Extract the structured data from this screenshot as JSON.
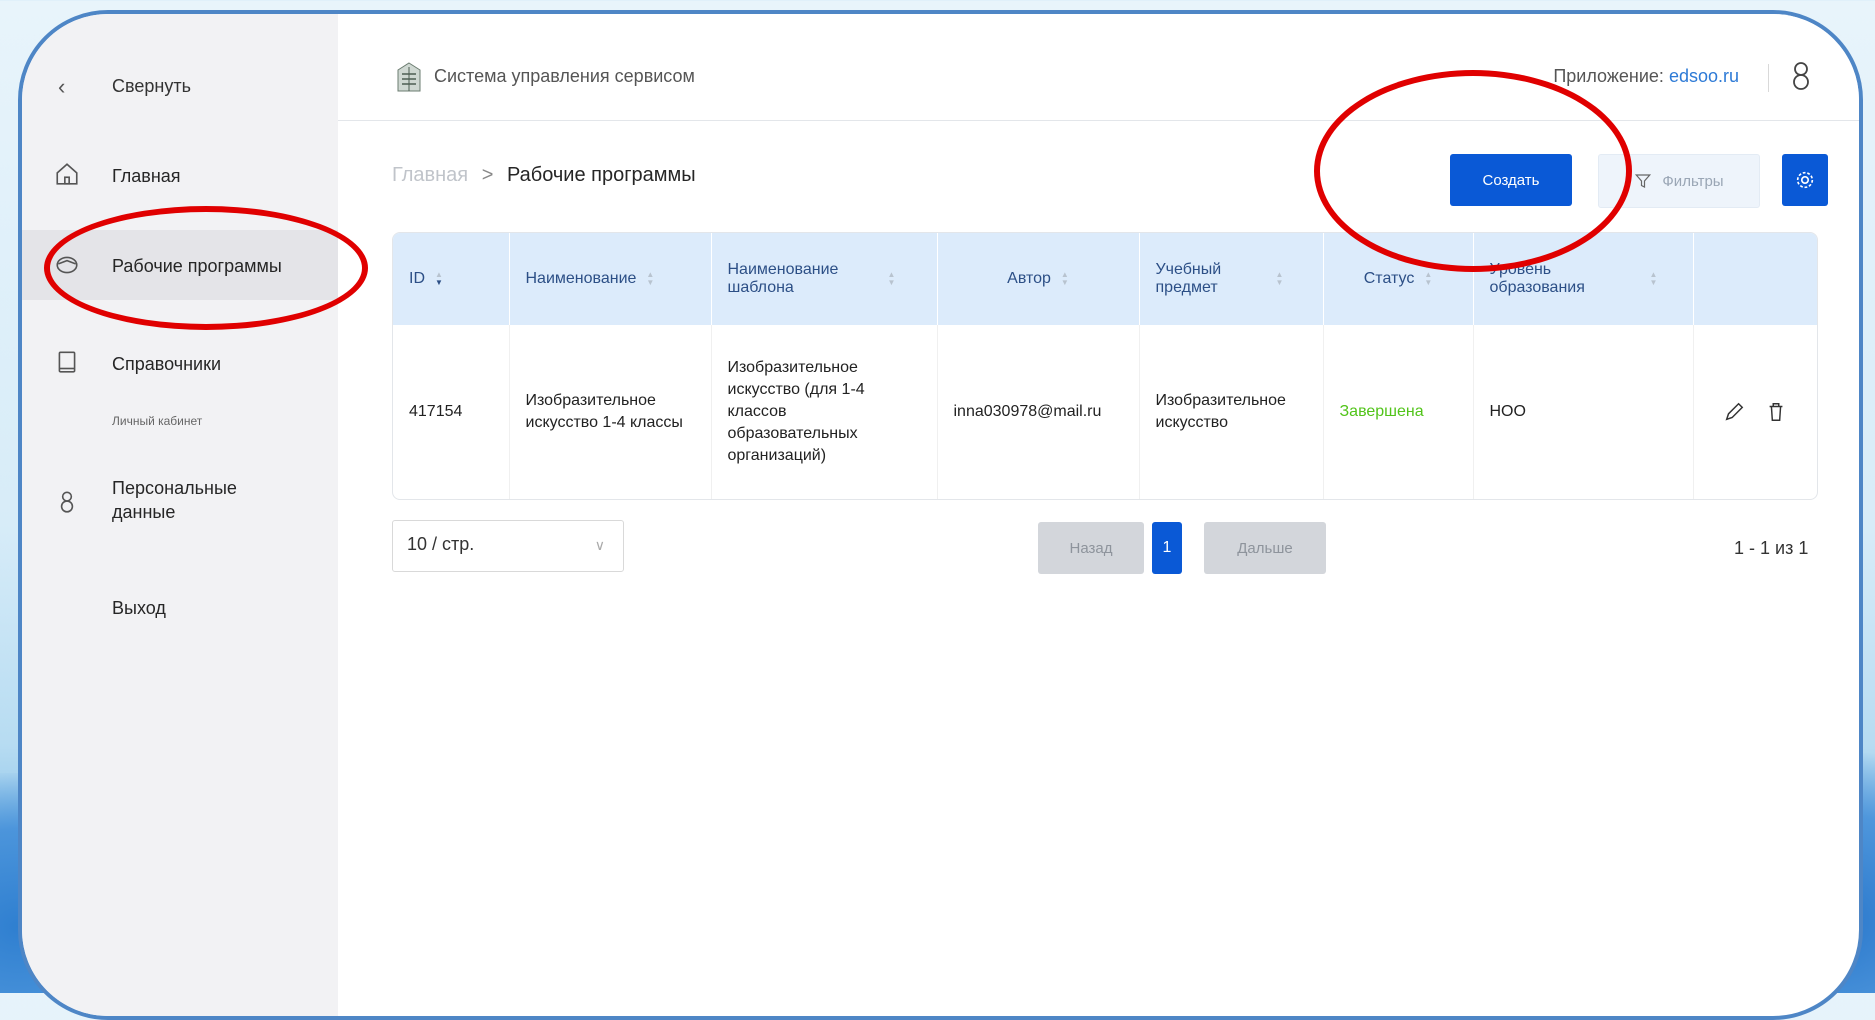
{
  "sidebar": {
    "collapse_label": "Свернуть",
    "items": [
      {
        "label": "Главная",
        "icon": "home-icon"
      },
      {
        "label": "Рабочие программы",
        "icon": "graduation-cap-icon",
        "active": true
      },
      {
        "label": "Справочники",
        "icon": "book-icon"
      }
    ],
    "caption": "Личный кабинет",
    "personal_label": "Персональные данные",
    "logout_label": "Выход"
  },
  "topbar": {
    "system_title": "Система управления сервисом",
    "app_prefix": "Приложение:",
    "app_link": "edsoo.ru"
  },
  "breadcrumb": {
    "home": "Главная",
    "separator": ">",
    "current": "Рабочие программы"
  },
  "toolbar": {
    "create_label": "Создать",
    "filter_label": "Фильтры"
  },
  "table": {
    "headers": [
      "ID",
      "Наименование",
      "Наименование шаблона",
      "Автор",
      "Учебный предмет",
      "Статус",
      "Уровень образования"
    ],
    "rows": [
      {
        "id": "417154",
        "name": "Изобразительное искусство 1-4 классы",
        "template": "Изобразительное искусство (для 1-4 классов образовательных организаций)",
        "author": "inna030978@mail.ru",
        "subject": "Изобразительное искусство",
        "status": "Завершена",
        "level": "НОО"
      }
    ]
  },
  "pagination": {
    "page_size": "10 / стр.",
    "prev_label": "Назад",
    "current_page": "1",
    "next_label": "Дальше",
    "range_text": "1 - 1 из 1"
  },
  "colors": {
    "accent": "#0a59d6",
    "header_bg": "#dcebfb",
    "status_done": "#52c41a",
    "annotation": "#e00000"
  }
}
